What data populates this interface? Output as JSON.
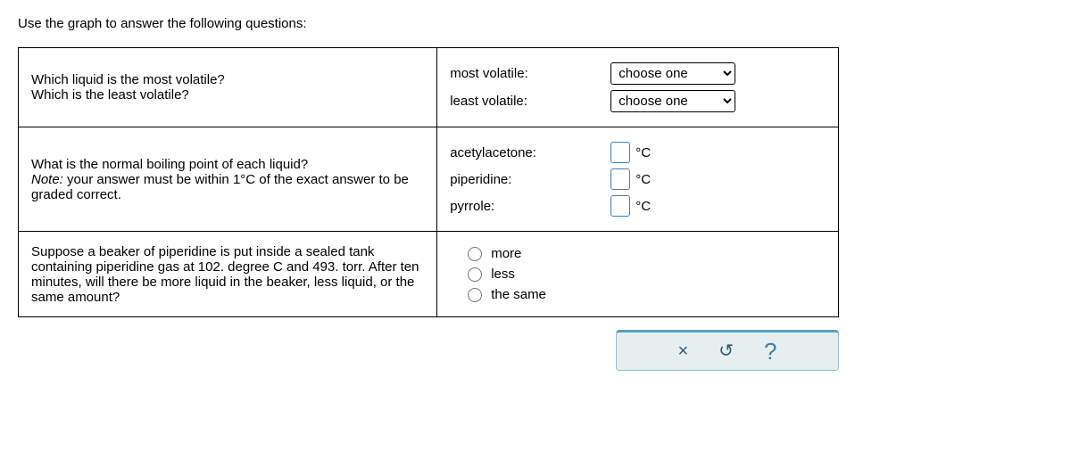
{
  "instruction": "Use the graph to answer the following questions:",
  "q1": {
    "prompt_line1": "Which liquid is the most volatile?",
    "prompt_line2": "Which is the least volatile?",
    "rows": [
      {
        "label": "most volatile:",
        "selected": "choose one"
      },
      {
        "label": "least volatile:",
        "selected": "choose one"
      }
    ]
  },
  "q2": {
    "prompt_line1": "What is the normal boiling point of each liquid?",
    "note_prefix": "Note:",
    "note_rest": " your answer must be within 1°C of the exact answer to be graded correct.",
    "rows": [
      {
        "label": "acetylacetone:",
        "value": "",
        "unit": "°C"
      },
      {
        "label": "piperidine:",
        "value": "",
        "unit": "°C"
      },
      {
        "label": "pyrrole:",
        "value": "",
        "unit": "°C"
      }
    ]
  },
  "q3": {
    "prompt": "Suppose a beaker of piperidine is put inside a sealed tank containing piperidine gas at 102. degree C and 493. torr. After ten minutes, will there be more liquid in the beaker, less liquid, or the same amount?",
    "options": [
      {
        "label": "more"
      },
      {
        "label": "less"
      },
      {
        "label": "the same"
      }
    ]
  },
  "toolbar": {
    "close": "×",
    "reset": "↺",
    "help": "?"
  }
}
